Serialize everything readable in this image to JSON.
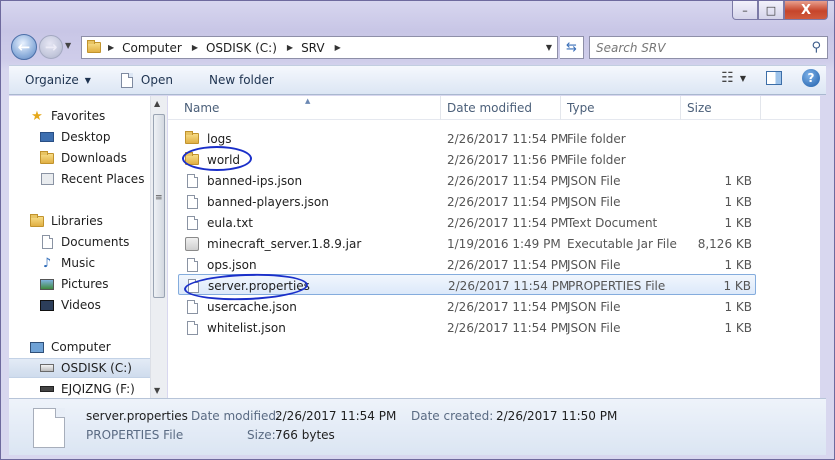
{
  "window": {
    "controls": {
      "minimize": "–",
      "maximize": "□",
      "close": "X"
    }
  },
  "address": {
    "crumbs": [
      "Computer",
      "OSDISK (C:)",
      "SRV"
    ],
    "search_placeholder": "Search SRV"
  },
  "toolbar": {
    "organize": "Organize",
    "open": "Open",
    "new_folder": "New folder"
  },
  "nav": {
    "favorites": "Favorites",
    "desktop": "Desktop",
    "downloads": "Downloads",
    "recent": "Recent Places",
    "libraries": "Libraries",
    "documents": "Documents",
    "music": "Music",
    "pictures": "Pictures",
    "videos": "Videos",
    "computer": "Computer",
    "osdisk": "OSDISK (C:)",
    "ejq": "EJQIZNG (F:)"
  },
  "columns": {
    "name": "Name",
    "date": "Date modified",
    "type": "Type",
    "size": "Size"
  },
  "files": [
    {
      "name": "logs",
      "date": "2/26/2017 11:54 PM",
      "type": "File folder",
      "size": "",
      "icon": "folder"
    },
    {
      "name": "world",
      "date": "2/26/2017 11:56 PM",
      "type": "File folder",
      "size": "",
      "icon": "folder"
    },
    {
      "name": "banned-ips.json",
      "date": "2/26/2017 11:54 PM",
      "type": "JSON File",
      "size": "1 KB",
      "icon": "file"
    },
    {
      "name": "banned-players.json",
      "date": "2/26/2017 11:54 PM",
      "type": "JSON File",
      "size": "1 KB",
      "icon": "file"
    },
    {
      "name": "eula.txt",
      "date": "2/26/2017 11:54 PM",
      "type": "Text Document",
      "size": "1 KB",
      "icon": "file"
    },
    {
      "name": "minecraft_server.1.8.9.jar",
      "date": "1/19/2016 1:49 PM",
      "type": "Executable Jar File",
      "size": "8,126 KB",
      "icon": "jar"
    },
    {
      "name": "ops.json",
      "date": "2/26/2017 11:54 PM",
      "type": "JSON File",
      "size": "1 KB",
      "icon": "file"
    },
    {
      "name": "server.properties",
      "date": "2/26/2017 11:54 PM",
      "type": "PROPERTIES File",
      "size": "1 KB",
      "icon": "file"
    },
    {
      "name": "usercache.json",
      "date": "2/26/2017 11:54 PM",
      "type": "JSON File",
      "size": "1 KB",
      "icon": "file"
    },
    {
      "name": "whitelist.json",
      "date": "2/26/2017 11:54 PM",
      "type": "JSON File",
      "size": "1 KB",
      "icon": "file"
    }
  ],
  "details": {
    "name": "server.properties",
    "type": "PROPERTIES File",
    "modified_label": "Date modified:",
    "modified": "2/26/2017 11:54 PM",
    "created_label": "Date created:",
    "created": "2/26/2017 11:50 PM",
    "size_label": "Size:",
    "size": "766 bytes"
  }
}
